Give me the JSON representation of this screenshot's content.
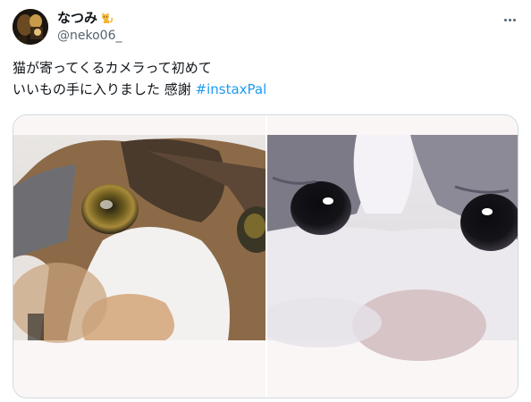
{
  "user": {
    "display_name": "なつみ",
    "handle": "@neko06_",
    "name_emoji": "cat-emoji"
  },
  "tweet": {
    "lines": [
      "猫が寄ってくるカメラって初めて",
      "いいもの手に入りました 感謝 "
    ],
    "hashtag": "#instaxPal"
  },
  "media": {
    "images": [
      {
        "name": "calico-cat-closeup",
        "alt": ""
      },
      {
        "name": "gray-white-cat-closeup",
        "alt": ""
      }
    ]
  },
  "icons": {
    "more": "more-horizontal-icon",
    "avatar": "avatar-image"
  },
  "colors": {
    "text": "#0f1419",
    "secondary": "#536471",
    "link": "#1d9bf0",
    "border": "#cfd9de"
  }
}
